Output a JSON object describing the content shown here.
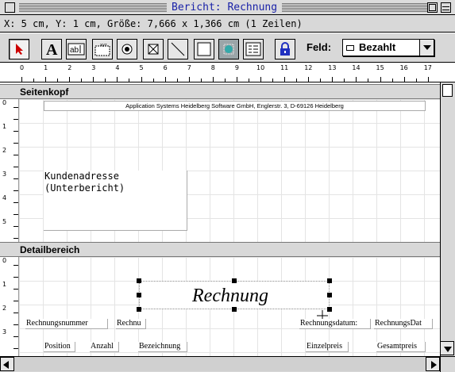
{
  "window": {
    "title": "Bericht: Rechnung"
  },
  "status": {
    "text": "X: 5 cm, Y: 1 cm, Größe: 7,666 x 1,366 cm (1 Zeilen)"
  },
  "toolbar": {
    "tools": [
      {
        "name": "arrow-pointer-icon",
        "glyph": "arrow"
      },
      {
        "name": "text-tool-icon",
        "glyph": "A"
      },
      {
        "name": "field-tool-icon",
        "glyph": "ab|"
      },
      {
        "name": "xyz-field-icon",
        "glyph": "xyz"
      },
      {
        "name": "radio-button-tool-icon",
        "glyph": "radio"
      },
      {
        "name": "checkbox-tool-icon",
        "glyph": "check"
      },
      {
        "name": "line-tool-icon",
        "glyph": "line"
      },
      {
        "name": "rectangle-tool-icon",
        "glyph": "rect"
      },
      {
        "name": "picture-tool-icon",
        "glyph": "pic"
      },
      {
        "name": "subreport-tool-icon",
        "glyph": "sub"
      }
    ],
    "lock_icon": "lock-icon",
    "field_label": "Feld:",
    "field_value": "Bezahlt"
  },
  "ruler": {
    "labels": [
      "0",
      "1",
      "2",
      "3",
      "4",
      "5",
      "6",
      "7",
      "8",
      "9",
      "10",
      "11",
      "12",
      "13",
      "14",
      "15",
      "16",
      "17"
    ]
  },
  "sections": [
    {
      "label": "Seitenkopf",
      "vruler": [
        "0",
        "1",
        "2",
        "3",
        "4",
        "5"
      ]
    },
    {
      "label": "Detailbereich",
      "vruler": [
        "0",
        "1",
        "2",
        "3"
      ]
    }
  ],
  "header": {
    "company_line": "Application Systems Heidelberg Software GmbH, Englerstr. 3, D-69126 Heidelberg",
    "address_box": "Kundenadresse\n(Unterbericht)"
  },
  "detail": {
    "title": "Rechnung",
    "fields_row1": [
      "Rechnungsnummer",
      "Rechnu",
      "Rechnungsdatum:",
      "RechnungsDat"
    ],
    "fields_row2": [
      "Position",
      "Anzahl",
      "Bezeichnung",
      "Einzelpreis",
      "Gesamtpreis"
    ]
  },
  "colors": {
    "title_text": "#1a22a8",
    "chrome": "#d8d8d8",
    "pointer": "#cc0000",
    "lock": "#2030c0"
  }
}
